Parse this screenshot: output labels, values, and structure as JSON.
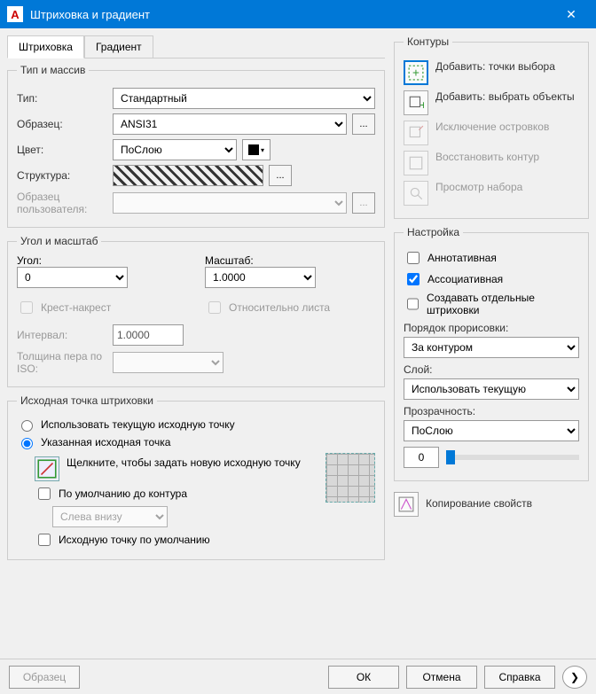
{
  "window": {
    "title": "Штриховка и градиент",
    "app_letter": "A"
  },
  "tabs": {
    "hatch": "Штриховка",
    "gradient": "Градиент"
  },
  "type_array": {
    "legend": "Тип и массив",
    "type_label": "Тип:",
    "type_value": "Стандартный",
    "pattern_label": "Образец:",
    "pattern_value": "ANSI31",
    "color_label": "Цвет:",
    "color_value": "ПоСлою",
    "swatch_label": "Структура:",
    "custom_label": "Образец пользователя:"
  },
  "angle_scale": {
    "legend": "Угол и масштаб",
    "angle_label": "Угол:",
    "angle_value": "0",
    "scale_label": "Масштаб:",
    "scale_value": "1.0000",
    "double_label": "Крест-накрест",
    "rel_paper_label": "Относительно листа",
    "spacing_label": "Интервал:",
    "spacing_value": "1.0000",
    "iso_label": "Толщина пера по ISO:"
  },
  "origin": {
    "legend": "Исходная точка штриховки",
    "use_current": "Использовать текущую исходную точку",
    "specified": "Указанная исходная точка",
    "click_text": "Щелкните, чтобы задать новую исходную точку",
    "default_bound": "По умолчанию до контура",
    "position": "Слева внизу",
    "store_default": "Исходную точку по умолчанию"
  },
  "boundaries": {
    "legend": "Контуры",
    "add_pick": "Добавить: точки выбора",
    "add_select": "Добавить: выбрать объекты",
    "remove": "Исключение островков",
    "recreate": "Восстановить контур",
    "view_sel": "Просмотр набора"
  },
  "options": {
    "legend": "Настройка",
    "annotative": "Аннотативная",
    "associative": "Ассоциативная",
    "separate": "Создавать отдельные штриховки",
    "draw_order_label": "Порядок прорисовки:",
    "draw_order_value": "За контуром",
    "layer_label": "Слой:",
    "layer_value": "Использовать текущую",
    "transparency_label": "Прозрачность:",
    "transparency_value": "ПоСлою",
    "transparency_num": "0"
  },
  "inherit": {
    "label": "Копирование свойств"
  },
  "footer": {
    "preview": "Образец",
    "ok": "ОК",
    "cancel": "Отмена",
    "help": "Справка"
  }
}
